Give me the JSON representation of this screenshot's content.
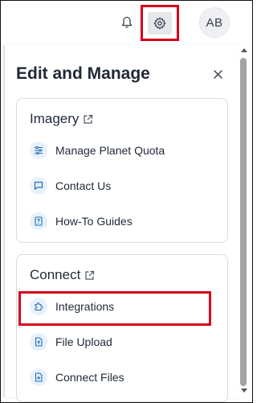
{
  "header": {
    "avatar_initials": "AB",
    "icons": {
      "notifications": "bell-icon",
      "settings": "gear-icon"
    }
  },
  "panel": {
    "title": "Edit and Manage",
    "close_icon": "close-icon"
  },
  "sections": {
    "imagery": {
      "heading": "Imagery",
      "items": [
        {
          "label": "Manage Planet Quota",
          "icon": "sliders-icon"
        },
        {
          "label": "Contact Us",
          "icon": "chat-icon"
        },
        {
          "label": "How-To Guides",
          "icon": "help-doc-icon"
        }
      ]
    },
    "connect": {
      "heading": "Connect",
      "items": [
        {
          "label": "Integrations",
          "icon": "puzzle-icon"
        },
        {
          "label": "File Upload",
          "icon": "file-upload-icon"
        },
        {
          "label": "Connect Files",
          "icon": "file-add-icon"
        }
      ]
    }
  },
  "colors": {
    "highlight": "#d6001c",
    "icon_bg": "#e7f1fb",
    "icon_fg": "#1f6fb2"
  }
}
